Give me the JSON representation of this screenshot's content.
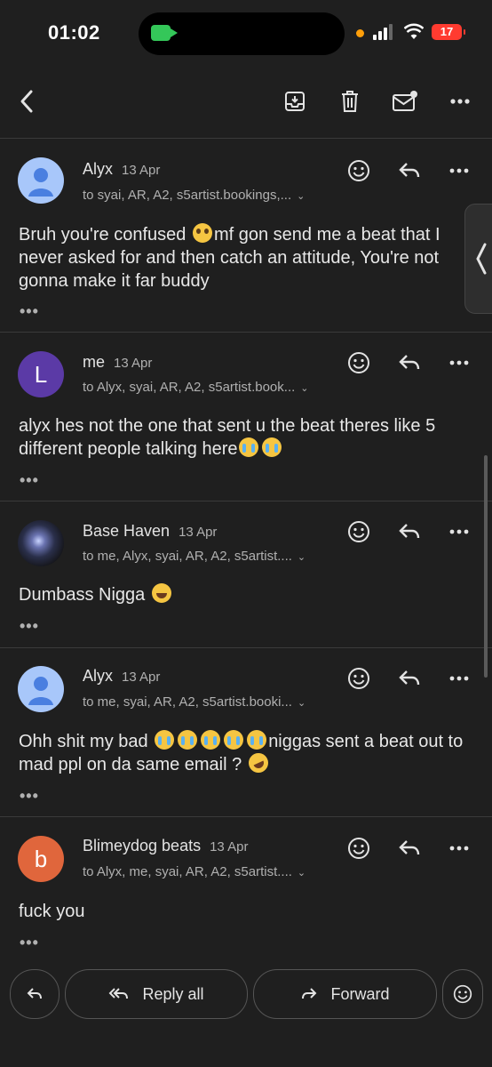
{
  "status_bar": {
    "time": "01:02",
    "battery": "17"
  },
  "toolbar": {
    "back_icon": "chevron-left-icon",
    "archive_icon": "archive-icon",
    "delete_icon": "trash-icon",
    "mark_unread_icon": "mail-unread-icon",
    "more_icon": "more-horizontal-icon"
  },
  "messages": [
    {
      "sender": "Alyx",
      "date": "13 Apr",
      "recipients": "to syai, AR, A2, s5artist.bookings,...",
      "avatar": {
        "type": "default"
      },
      "body": [
        {
          "t": "Bruh you're confused "
        },
        {
          "e": "pleading"
        },
        {
          "t": "mf gon send me a beat that I never asked for and then catch an attitude, You're not gonna make it far buddy"
        }
      ],
      "ellipsis": "•••"
    },
    {
      "sender": "me",
      "date": "13 Apr",
      "recipients": "to Alyx, syai, AR, A2, s5artist.book...",
      "avatar": {
        "type": "letter",
        "letter": "L",
        "color": "#5b3aa6"
      },
      "body": [
        {
          "t": "alyx hes not the one that sent u the beat theres like 5 different people talking here"
        },
        {
          "e": "cry"
        },
        {
          "e": "cry"
        }
      ],
      "ellipsis": "•••"
    },
    {
      "sender": "Base Haven",
      "date": "13 Apr",
      "recipients": "to me, Alyx, syai, AR, A2, s5artist....",
      "avatar": {
        "type": "image"
      },
      "body": [
        {
          "t": "Dumbass Nigga "
        },
        {
          "e": "laugh"
        }
      ],
      "ellipsis": "•••"
    },
    {
      "sender": "Alyx",
      "date": "13 Apr",
      "recipients": "to me, syai, AR, A2, s5artist.booki...",
      "avatar": {
        "type": "default"
      },
      "body": [
        {
          "t": "Ohh shit my bad "
        },
        {
          "e": "cry"
        },
        {
          "e": "cry"
        },
        {
          "e": "cry"
        },
        {
          "e": "cry"
        },
        {
          "e": "cry"
        },
        {
          "t": "niggas sent a beat out to mad ppl on da same email ? "
        },
        {
          "e": "rofl"
        }
      ],
      "ellipsis": "•••"
    },
    {
      "sender": "Blimeydog beats",
      "date": "13 Apr",
      "recipients": "to Alyx, me, syai, AR, A2, s5artist....",
      "avatar": {
        "type": "letter",
        "letter": "b",
        "color": "#e0663c"
      },
      "body": [
        {
          "t": "fuck you"
        }
      ],
      "ellipsis": "•••"
    }
  ],
  "bottom_actions": {
    "reply_all": "Reply all",
    "forward": "Forward"
  }
}
